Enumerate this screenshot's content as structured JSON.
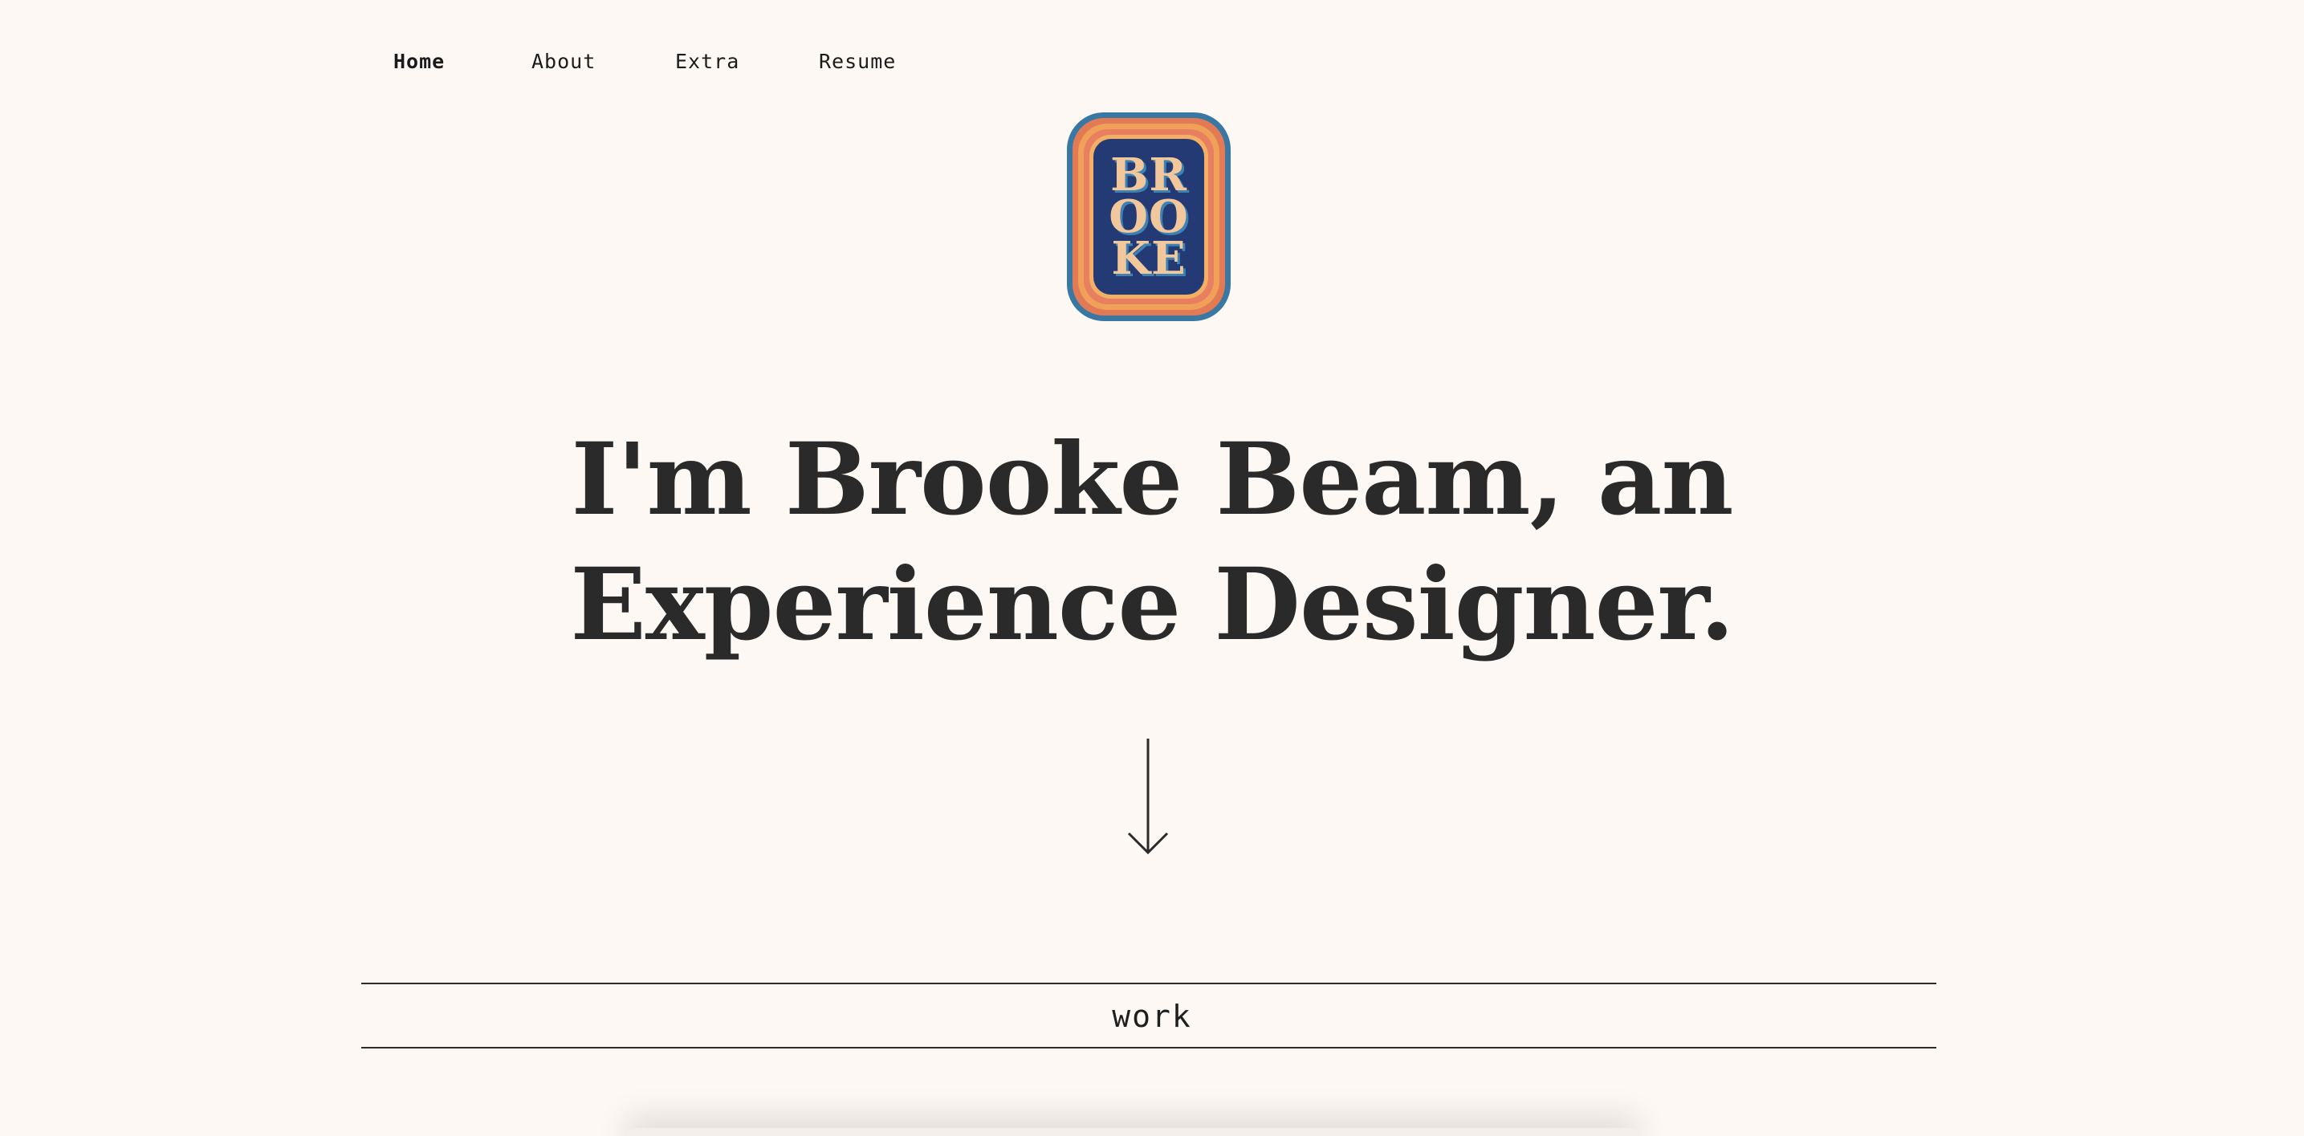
{
  "nav": {
    "items": [
      {
        "label": "Home",
        "active": true
      },
      {
        "label": "About",
        "active": false
      },
      {
        "label": "Extra",
        "active": false
      },
      {
        "label": "Resume",
        "active": false
      }
    ]
  },
  "logo": {
    "lines": [
      "BR",
      "OO",
      "KE"
    ]
  },
  "hero": {
    "line1": "I'm Brooke Beam, an",
    "line2": "Experience Designer."
  },
  "scroll_arrow": {
    "icon": "arrow-down-icon"
  },
  "section": {
    "label": "work"
  },
  "colors": {
    "background": "#fdf8f4",
    "text": "#2a2a2a",
    "logo_border": "#3878a3",
    "logo_core": "#243a74",
    "logo_text": "#f2c79c"
  }
}
